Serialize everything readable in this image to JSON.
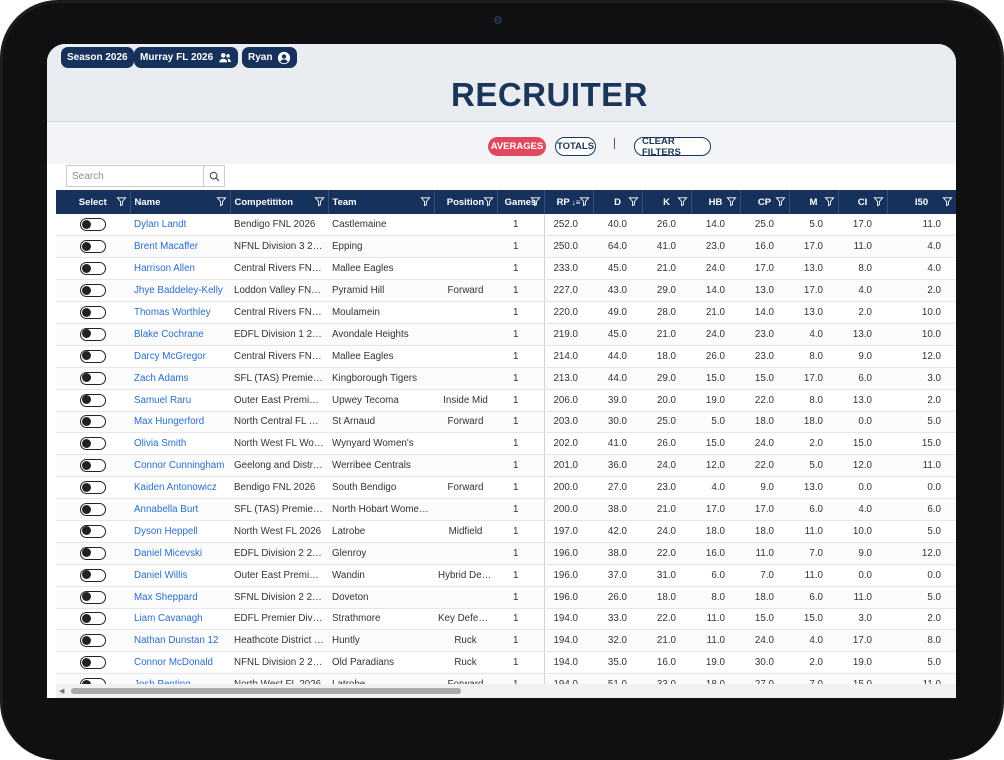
{
  "header": {
    "season_label": "Season 2026",
    "league_label": "Murray FL 2026",
    "user_label": "Ryan",
    "title": "RECRUITER"
  },
  "toolbar": {
    "averages_label": "AVERAGES",
    "totals_label": "TOTALS",
    "separator": "|",
    "clear_filters_label": "CLEAR FILTERS"
  },
  "search": {
    "placeholder": "Search",
    "value": ""
  },
  "colors": {
    "navy": "#16325c",
    "accent_red": "#e0485f",
    "link_blue": "#2a6fc9"
  },
  "table": {
    "columns": [
      "Select",
      "Name",
      "Competititon",
      "Team",
      "Position",
      "Games",
      "RP",
      "D",
      "K",
      "HB",
      "CP",
      "M",
      "CI",
      "I50"
    ],
    "sort_column": "RP",
    "sort_direction": "descending",
    "rows": [
      {
        "name": "Dylan Landt",
        "competition": "Bendigo FNL 2026",
        "team": "Castlemaine",
        "position": "",
        "games": "1",
        "rp": "252.0",
        "d": "40.0",
        "k": "26.0",
        "hb": "14.0",
        "cp": "25.0",
        "m": "5.0",
        "ci": "17.0",
        "i50": "11.0"
      },
      {
        "name": "Brent Macaffer",
        "competition": "NFNL Division 3 2026",
        "team": "Epping",
        "position": "",
        "games": "1",
        "rp": "250.0",
        "d": "64.0",
        "k": "41.0",
        "hb": "23.0",
        "cp": "16.0",
        "m": "17.0",
        "ci": "11.0",
        "i50": "4.0"
      },
      {
        "name": "Harrison Allen",
        "competition": "Central Rivers FNL 2...",
        "team": "Mallee Eagles",
        "position": "",
        "games": "1",
        "rp": "233.0",
        "d": "45.0",
        "k": "21.0",
        "hb": "24.0",
        "cp": "17.0",
        "m": "13.0",
        "ci": "8.0",
        "i50": "4.0"
      },
      {
        "name": "Jhye Baddeley-Kelly",
        "competition": "Loddon Valley FNL ...",
        "team": "Pyramid Hill",
        "position": "Forward",
        "games": "1",
        "rp": "227.0",
        "d": "43.0",
        "k": "29.0",
        "hb": "14.0",
        "cp": "13.0",
        "m": "17.0",
        "ci": "4.0",
        "i50": "2.0"
      },
      {
        "name": "Thomas Worthley",
        "competition": "Central Rivers FNL 2...",
        "team": "Moulamein",
        "position": "",
        "games": "1",
        "rp": "220.0",
        "d": "49.0",
        "k": "28.0",
        "hb": "21.0",
        "cp": "14.0",
        "m": "13.0",
        "ci": "2.0",
        "i50": "10.0"
      },
      {
        "name": "Blake Cochrane",
        "competition": "EDFL Division 1 2026",
        "team": "Avondale Heights",
        "position": "",
        "games": "1",
        "rp": "219.0",
        "d": "45.0",
        "k": "21.0",
        "hb": "24.0",
        "cp": "23.0",
        "m": "4.0",
        "ci": "13.0",
        "i50": "10.0"
      },
      {
        "name": "Darcy McGregor",
        "competition": "Central Rivers FNL 2...",
        "team": "Mallee Eagles",
        "position": "",
        "games": "1",
        "rp": "214.0",
        "d": "44.0",
        "k": "18.0",
        "hb": "26.0",
        "cp": "23.0",
        "m": "8.0",
        "ci": "9.0",
        "i50": "12.0"
      },
      {
        "name": "Zach Adams",
        "competition": "SFL (TAS) Premier L...",
        "team": "Kingborough Tigers",
        "position": "",
        "games": "1",
        "rp": "213.0",
        "d": "44.0",
        "k": "29.0",
        "hb": "15.0",
        "cp": "15.0",
        "m": "17.0",
        "ci": "6.0",
        "i50": "3.0"
      },
      {
        "name": "Samuel Raru",
        "competition": "Outer East Premier ...",
        "team": "Upwey Tecoma",
        "position": "Inside Mid",
        "games": "1",
        "rp": "206.0",
        "d": "39.0",
        "k": "20.0",
        "hb": "19.0",
        "cp": "22.0",
        "m": "8.0",
        "ci": "13.0",
        "i50": "2.0"
      },
      {
        "name": "Max Hungerford",
        "competition": "North Central FL 20...",
        "team": "St Arnaud",
        "position": "Forward",
        "games": "1",
        "rp": "203.0",
        "d": "30.0",
        "k": "25.0",
        "hb": "5.0",
        "cp": "18.0",
        "m": "18.0",
        "ci": "0.0",
        "i50": "5.0"
      },
      {
        "name": "Olivia Smith",
        "competition": "North West FL Wom...",
        "team": "Wynyard Women's",
        "position": "",
        "games": "1",
        "rp": "202.0",
        "d": "41.0",
        "k": "26.0",
        "hb": "15.0",
        "cp": "24.0",
        "m": "2.0",
        "ci": "15.0",
        "i50": "15.0"
      },
      {
        "name": "Connor Cunningham",
        "competition": "Geelong and Distric...",
        "team": "Werribee Centrals",
        "position": "",
        "games": "1",
        "rp": "201.0",
        "d": "36.0",
        "k": "24.0",
        "hb": "12.0",
        "cp": "22.0",
        "m": "5.0",
        "ci": "12.0",
        "i50": "11.0"
      },
      {
        "name": "Kaiden Antonowicz",
        "competition": "Bendigo FNL 2026",
        "team": "South Bendigo",
        "position": "Forward",
        "games": "1",
        "rp": "200.0",
        "d": "27.0",
        "k": "23.0",
        "hb": "4.0",
        "cp": "9.0",
        "m": "13.0",
        "ci": "0.0",
        "i50": "0.0"
      },
      {
        "name": "Annabella Burt",
        "competition": "SFL (TAS) Premier L...",
        "team": "North Hobart Women's",
        "position": "",
        "games": "1",
        "rp": "200.0",
        "d": "38.0",
        "k": "21.0",
        "hb": "17.0",
        "cp": "17.0",
        "m": "6.0",
        "ci": "4.0",
        "i50": "6.0"
      },
      {
        "name": "Dyson Heppell",
        "competition": "North West FL 2026",
        "team": "Latrobe",
        "position": "Midfield",
        "games": "1",
        "rp": "197.0",
        "d": "42.0",
        "k": "24.0",
        "hb": "18.0",
        "cp": "18.0",
        "m": "11.0",
        "ci": "10.0",
        "i50": "5.0"
      },
      {
        "name": "Daniel Micevski",
        "competition": "EDFL Division 2 2026",
        "team": "Glenroy",
        "position": "",
        "games": "1",
        "rp": "196.0",
        "d": "38.0",
        "k": "22.0",
        "hb": "16.0",
        "cp": "11.0",
        "m": "7.0",
        "ci": "9.0",
        "i50": "12.0"
      },
      {
        "name": "Daniel Willis",
        "competition": "Outer East Premier ...",
        "team": "Wandin",
        "position": "Hybrid Defen...",
        "games": "1",
        "rp": "196.0",
        "d": "37.0",
        "k": "31.0",
        "hb": "6.0",
        "cp": "7.0",
        "m": "11.0",
        "ci": "0.0",
        "i50": "0.0"
      },
      {
        "name": "Max Sheppard",
        "competition": "SFNL Division 2 2026",
        "team": "Doveton",
        "position": "",
        "games": "1",
        "rp": "196.0",
        "d": "26.0",
        "k": "18.0",
        "hb": "8.0",
        "cp": "18.0",
        "m": "6.0",
        "ci": "11.0",
        "i50": "5.0"
      },
      {
        "name": "Liam Cavanagh",
        "competition": "EDFL Premier Divisi...",
        "team": "Strathmore",
        "position": "Key Defender",
        "games": "1",
        "rp": "194.0",
        "d": "33.0",
        "k": "22.0",
        "hb": "11.0",
        "cp": "15.0",
        "m": "15.0",
        "ci": "3.0",
        "i50": "2.0"
      },
      {
        "name": "Nathan Dunstan 12",
        "competition": "Heathcote District F...",
        "team": "Huntly",
        "position": "Ruck",
        "games": "1",
        "rp": "194.0",
        "d": "32.0",
        "k": "21.0",
        "hb": "11.0",
        "cp": "24.0",
        "m": "4.0",
        "ci": "17.0",
        "i50": "8.0"
      },
      {
        "name": "Connor McDonald",
        "competition": "NFNL Division 2 2026",
        "team": "Old Paradians",
        "position": "Ruck",
        "games": "1",
        "rp": "194.0",
        "d": "35.0",
        "k": "16.0",
        "hb": "19.0",
        "cp": "30.0",
        "m": "2.0",
        "ci": "19.0",
        "i50": "5.0"
      },
      {
        "name": "Josh Penting",
        "competition": "North West FL 2026",
        "team": "Latrobe",
        "position": "Forward",
        "games": "1",
        "rp": "194.0",
        "d": "51.0",
        "k": "33.0",
        "hb": "18.0",
        "cp": "27.0",
        "m": "7.0",
        "ci": "15.0",
        "i50": "11.0"
      }
    ]
  }
}
